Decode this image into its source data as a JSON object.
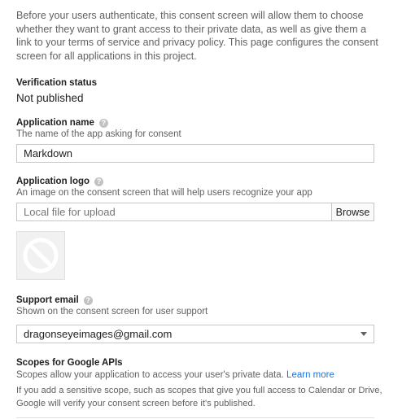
{
  "intro_text": "Before your users authenticate, this consent screen will allow them to choose whether they want to grant access to their private data, as well as give them a link to your terms of service and privacy policy. This page configures the consent screen for all applications in this project.",
  "verification": {
    "label": "Verification status",
    "value": "Not published"
  },
  "app_name": {
    "label": "Application name",
    "hint": "The name of the app asking for consent",
    "value": "Markdown"
  },
  "app_logo": {
    "label": "Application logo",
    "hint": "An image on the consent screen that will help users recognize your app",
    "placeholder": "Local file for upload",
    "browse_label": "Browse"
  },
  "support_email": {
    "label": "Support email",
    "hint": "Shown on the consent screen for user support",
    "value": "dragonseyeimages@gmail.com"
  },
  "scopes": {
    "label": "Scopes for Google APIs",
    "hint": "Scopes allow your application to access your user's private data.",
    "learn_more": "Learn more",
    "note": "If you add a sensitive scope, such as scopes that give you full access to Calendar or Drive, Google will verify your consent screen before it's published."
  },
  "help_icon_glyph": "?",
  "colors": {
    "link": "#1a73e8",
    "help_icon": "#c2c2c2",
    "field_border": "#c6c6c6"
  }
}
